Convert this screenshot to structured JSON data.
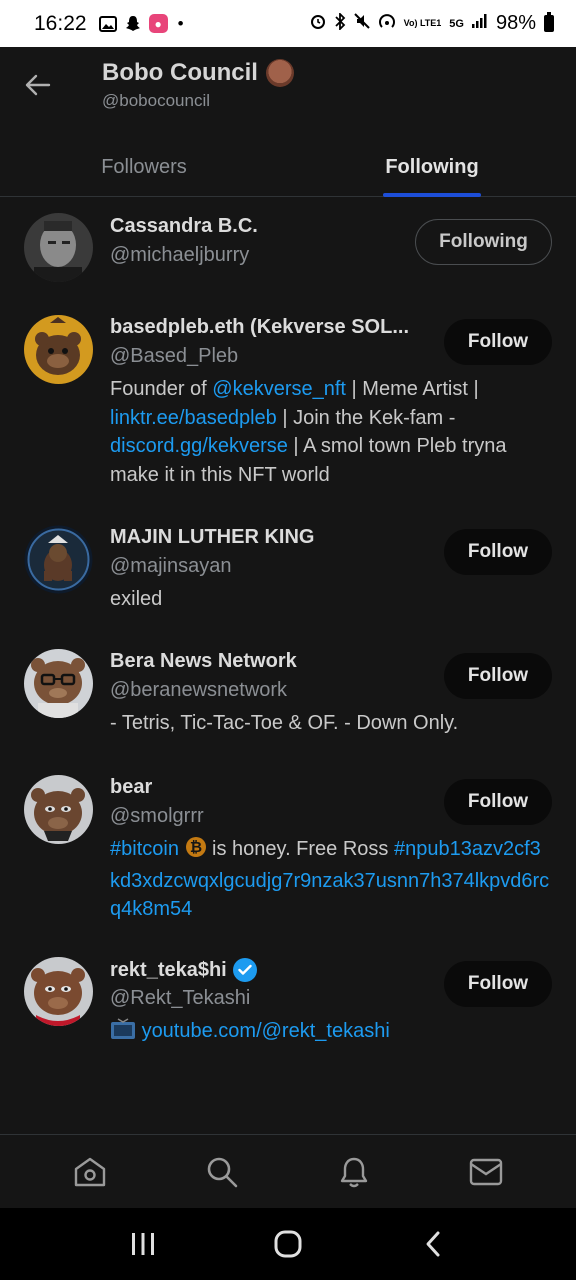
{
  "status_bar": {
    "time": "16:22",
    "signal_text": "5G",
    "volte_text": "Vo) LTE1",
    "battery": "98%"
  },
  "header": {
    "title": "Bobo Council",
    "handle": "@bobocouncil",
    "back_icon": "arrow-left-icon"
  },
  "tabs": [
    {
      "label": "Followers",
      "active": false
    },
    {
      "label": "Following",
      "active": true
    }
  ],
  "accounts": [
    {
      "name": "Cassandra B.C.",
      "handle": "@michaeljburry",
      "button": "Following",
      "bio": ""
    },
    {
      "name": "basedpleb.eth (Kekverse SOL...",
      "handle": "@Based_Pleb",
      "button": "Follow",
      "bio_parts": [
        "Founder of ",
        "@kekverse_nft",
        " | Meme Artist | ",
        "linktr.ee/basedpleb",
        " | Join the Kek-fam - ",
        "discord.gg/kekverse",
        " | A smol town Pleb tryna make it in this NFT world"
      ]
    },
    {
      "name": "MAJIN LUTHER KING",
      "handle": "@majinsayan",
      "button": "Follow",
      "bio": "exiled"
    },
    {
      "name": "Bera News Network",
      "handle": "@beranewsnetwork",
      "button": "Follow",
      "bio": "- Tetris, Tic-Tac-Toe & OF. - Down Only."
    },
    {
      "name": "bear",
      "handle": "@smolgrrr",
      "button": "Follow",
      "bio_parts": [
        "#bitcoin",
        " is honey. Free Ross ",
        "#npub13azv2cf3kd3xdzcwqxlgcudjg7r9nzak37usnn7h374lkpvd6rcq4k8m54"
      ]
    },
    {
      "name": "rekt_teka$hi",
      "handle": "@Rekt_Tekashi",
      "button": "Follow",
      "bio_link": "youtube.com/@rekt_tekashi"
    }
  ],
  "bottom_nav": [
    "home-icon",
    "search-icon",
    "notifications-icon",
    "messages-icon"
  ],
  "colors": {
    "background": "#151515",
    "link": "#1d9bf0",
    "tab_indicator": "#1d4ed8"
  }
}
